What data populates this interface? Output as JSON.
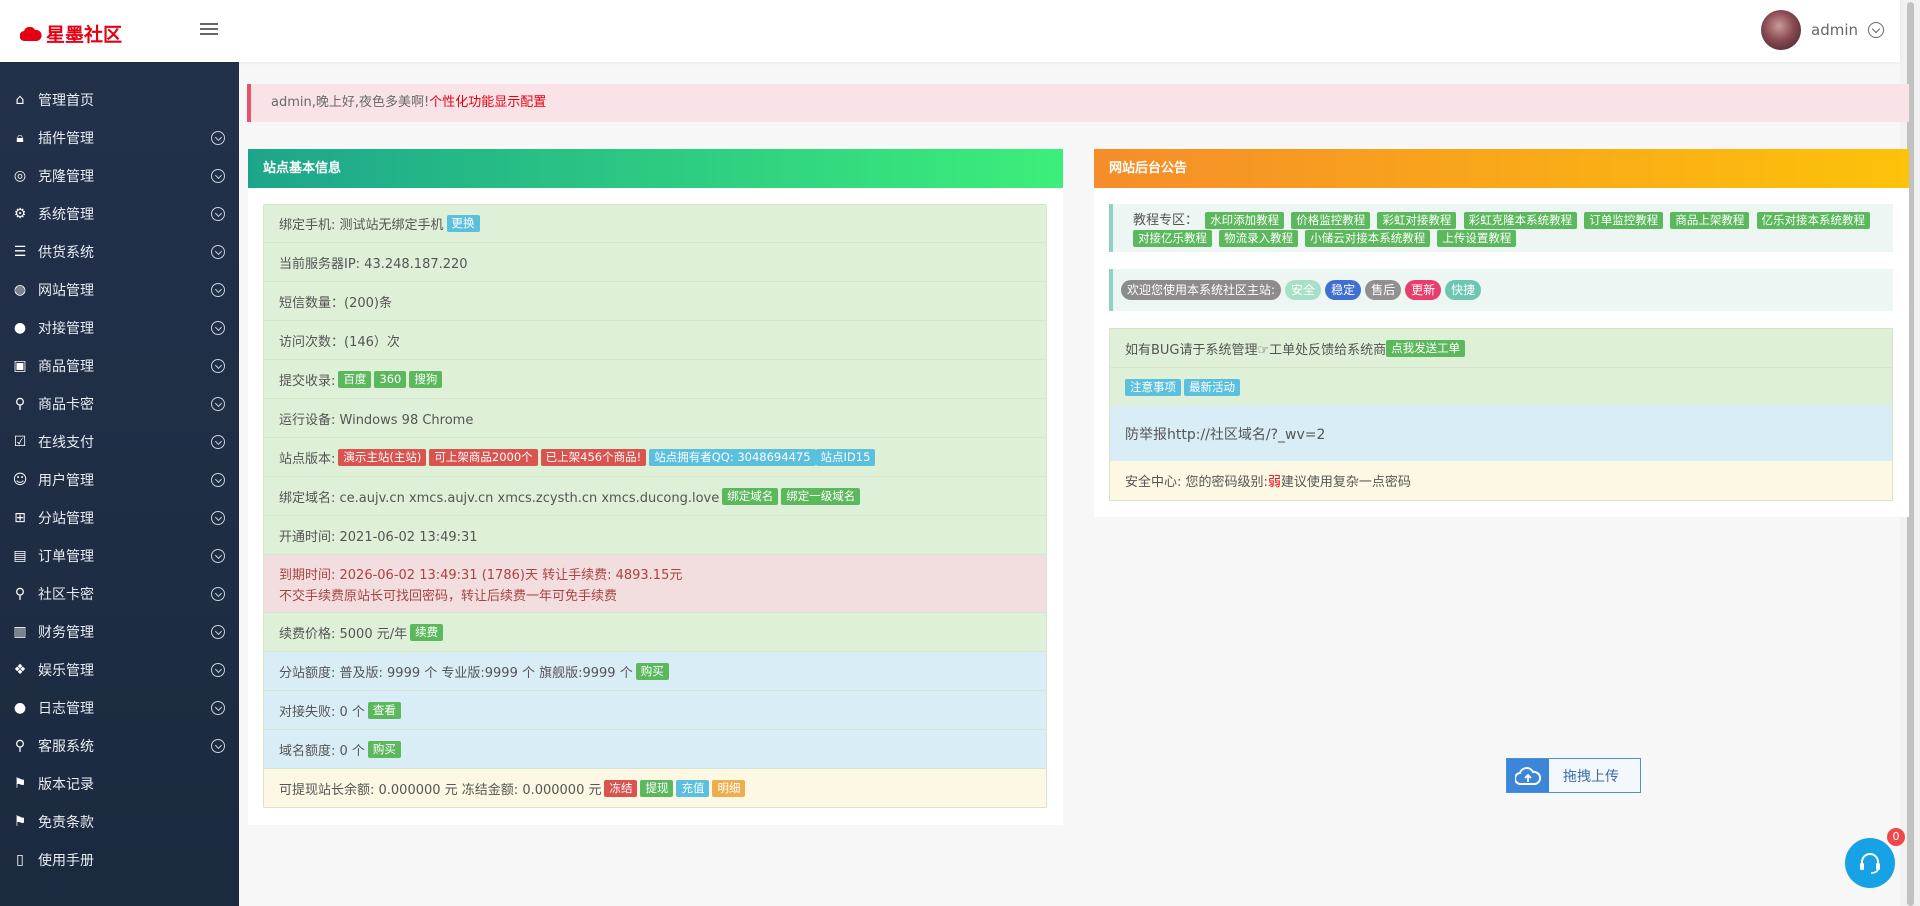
{
  "brand": {
    "name": "星墨社区",
    "color": "#e60012"
  },
  "header": {
    "username": "admin"
  },
  "sidebar": {
    "items": [
      {
        "label": "管理首页",
        "icon": "home-icon"
      },
      {
        "label": "插件管理",
        "icon": "lock-icon"
      },
      {
        "label": "克隆管理",
        "icon": "clone-icon"
      },
      {
        "label": "系统管理",
        "icon": "gear-icon"
      },
      {
        "label": "供货系统",
        "icon": "supply-icon"
      },
      {
        "label": "网站管理",
        "icon": "globe-icon"
      },
      {
        "label": "对接管理",
        "icon": "connect-icon"
      },
      {
        "label": "商品管理",
        "icon": "bag-icon"
      },
      {
        "label": "商品卡密",
        "icon": "key-icon"
      },
      {
        "label": "在线支付",
        "icon": "payment-icon"
      },
      {
        "label": "用户管理",
        "icon": "users-icon"
      },
      {
        "label": "分站管理",
        "icon": "sitemap-icon"
      },
      {
        "label": "订单管理",
        "icon": "order-icon"
      },
      {
        "label": "社区卡密",
        "icon": "card-key-icon"
      },
      {
        "label": "财务管理",
        "icon": "finance-icon"
      },
      {
        "label": "娱乐管理",
        "icon": "game-icon"
      },
      {
        "label": "日志管理",
        "icon": "apple-icon"
      },
      {
        "label": "客服系统",
        "icon": "service-icon"
      },
      {
        "label": "版本记录",
        "icon": "signpost-icon"
      },
      {
        "label": "免责条款",
        "icon": "signpost-icon"
      },
      {
        "label": "使用手册",
        "icon": "book-icon"
      }
    ]
  },
  "alert": {
    "text": "admin,晚上好,夜色多美啊!",
    "link": "个性化功能显示配置"
  },
  "left_panel": {
    "title": "站点基本信息",
    "bind_phone": {
      "label": "绑定手机: 测试站无绑定手机",
      "button": "更换"
    },
    "server_ip": "当前服务器IP: 43.248.187.220",
    "sms_count": "短信数量：(200)条",
    "visit_count": "访问次数：(146）次",
    "submit_index": {
      "label": "提交收录:",
      "tags": [
        "百度",
        "360",
        "搜狗"
      ]
    },
    "device": "运行设备: Windows 98 Chrome",
    "version": {
      "label": "站点版本:",
      "tags": [
        "演示主站(主站)",
        "可上架商品2000个",
        "已上架456个商品!"
      ],
      "qq": "站点拥有者QQ: 3048694475",
      "site_id": "站点ID15"
    },
    "domains": {
      "label": "绑定域名:  ce.aujv.cn xmcs.aujv.cn xmcs.zcysth.cn xmcs.ducong.love",
      "buttons": [
        "绑定域名",
        "绑定一级域名"
      ]
    },
    "open_time": "开通时间: 2021-06-02 13:49:31",
    "expire": {
      "line1": "到期时间: 2026-06-02 13:49:31 (1786)天 转让手续费: 4893.15元",
      "line2": "不交手续费原站长可找回密码，转让后续费一年可免手续费"
    },
    "renew": {
      "label": "续费价格: 5000 元/年",
      "button": "续费"
    },
    "quota": {
      "label": "分站额度: 普及版: 9999 个 专业版:9999 个 旗舰版:9999 个",
      "button": "购买"
    },
    "dock_fail": {
      "label": "对接失败: 0 个",
      "button": "查看"
    },
    "domain_quota": {
      "label": "域名额度: 0 个",
      "button": "购买"
    },
    "balance": {
      "label": "可提现站长余额: 0.000000 元 冻结金额: 0.000000 元",
      "buttons": [
        "冻结",
        "提现",
        "充值",
        "明细"
      ]
    }
  },
  "right_panel": {
    "title": "网站后台公告",
    "tutorials": {
      "label": "教程专区：",
      "items": [
        "水印添加教程",
        "价格监控教程",
        "彩虹对接教程",
        "彩虹克隆本系统教程",
        "订单监控教程",
        "商品上架教程",
        "亿乐对接本系统教程",
        "对接亿乐教程",
        "物流录入教程",
        "小储云对接本系统教程",
        "上传设置教程"
      ]
    },
    "welcome": {
      "label": "欢迎您使用本系统社区主站:",
      "pills": [
        "安全",
        "稳定",
        "售后",
        "更新",
        "快捷"
      ]
    },
    "bug": {
      "label": "如有BUG请于系统管理☞工单处反馈给系统商",
      "button": "点我发送工单"
    },
    "notes": [
      "注意事项",
      "最新活动"
    ],
    "anti_report": "防举报http://社区域名/?_wv=2",
    "security": {
      "label": "安全中心: 您的密码级别:",
      "level": "弱",
      "advice": " 建议使用复杂一点密码"
    }
  },
  "upload": {
    "label": "拖拽上传"
  },
  "chat": {
    "badge": "0"
  }
}
